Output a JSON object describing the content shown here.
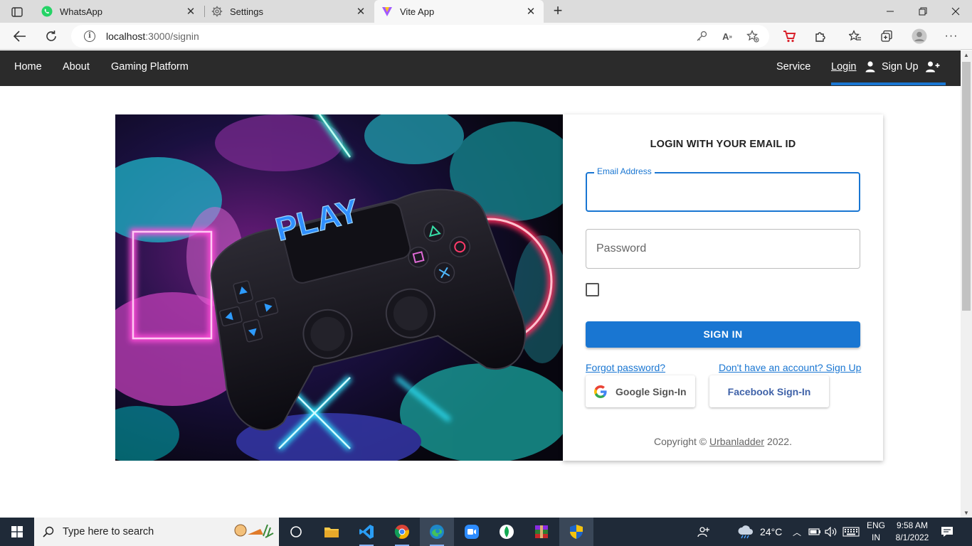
{
  "browser": {
    "tabs": [
      {
        "title": "WhatsApp",
        "icon": "whatsapp-icon"
      },
      {
        "title": "Settings",
        "icon": "gear-icon"
      },
      {
        "title": "Vite App",
        "icon": "vite-icon",
        "active": true
      }
    ],
    "url_host": "localhost",
    "url_path": ":3000/signin"
  },
  "nav": {
    "left": [
      "Home",
      "About",
      "Gaming Platform"
    ],
    "service": "Service",
    "login": "Login",
    "signup": "Sign Up"
  },
  "hero": {
    "text": "PLAY"
  },
  "login": {
    "title": "LOGIN WITH YOUR EMAIL ID",
    "email_label": "Email Address",
    "email_value": "",
    "password_placeholder": "Password",
    "signin_label": "SIGN IN",
    "forgot_link": "Forgot password?",
    "signup_link": "Don't have an account? Sign Up",
    "google_label": "Google Sign-In",
    "facebook_label": "Facebook Sign-In",
    "copyright_prefix": "Copyright ©",
    "copyright_brand": "Urbanladder",
    "copyright_suffix": "2022."
  },
  "taskbar": {
    "search_placeholder": "Type here to search",
    "temperature": "24°C",
    "lang_top": "ENG",
    "lang_bottom": "IN",
    "time": "9:58 AM",
    "date": "8/1/2022"
  },
  "colors": {
    "primary": "#1976d2",
    "navbar": "#2b2b2b",
    "taskbar": "#1f2a38",
    "facebook": "#3f62a8"
  }
}
